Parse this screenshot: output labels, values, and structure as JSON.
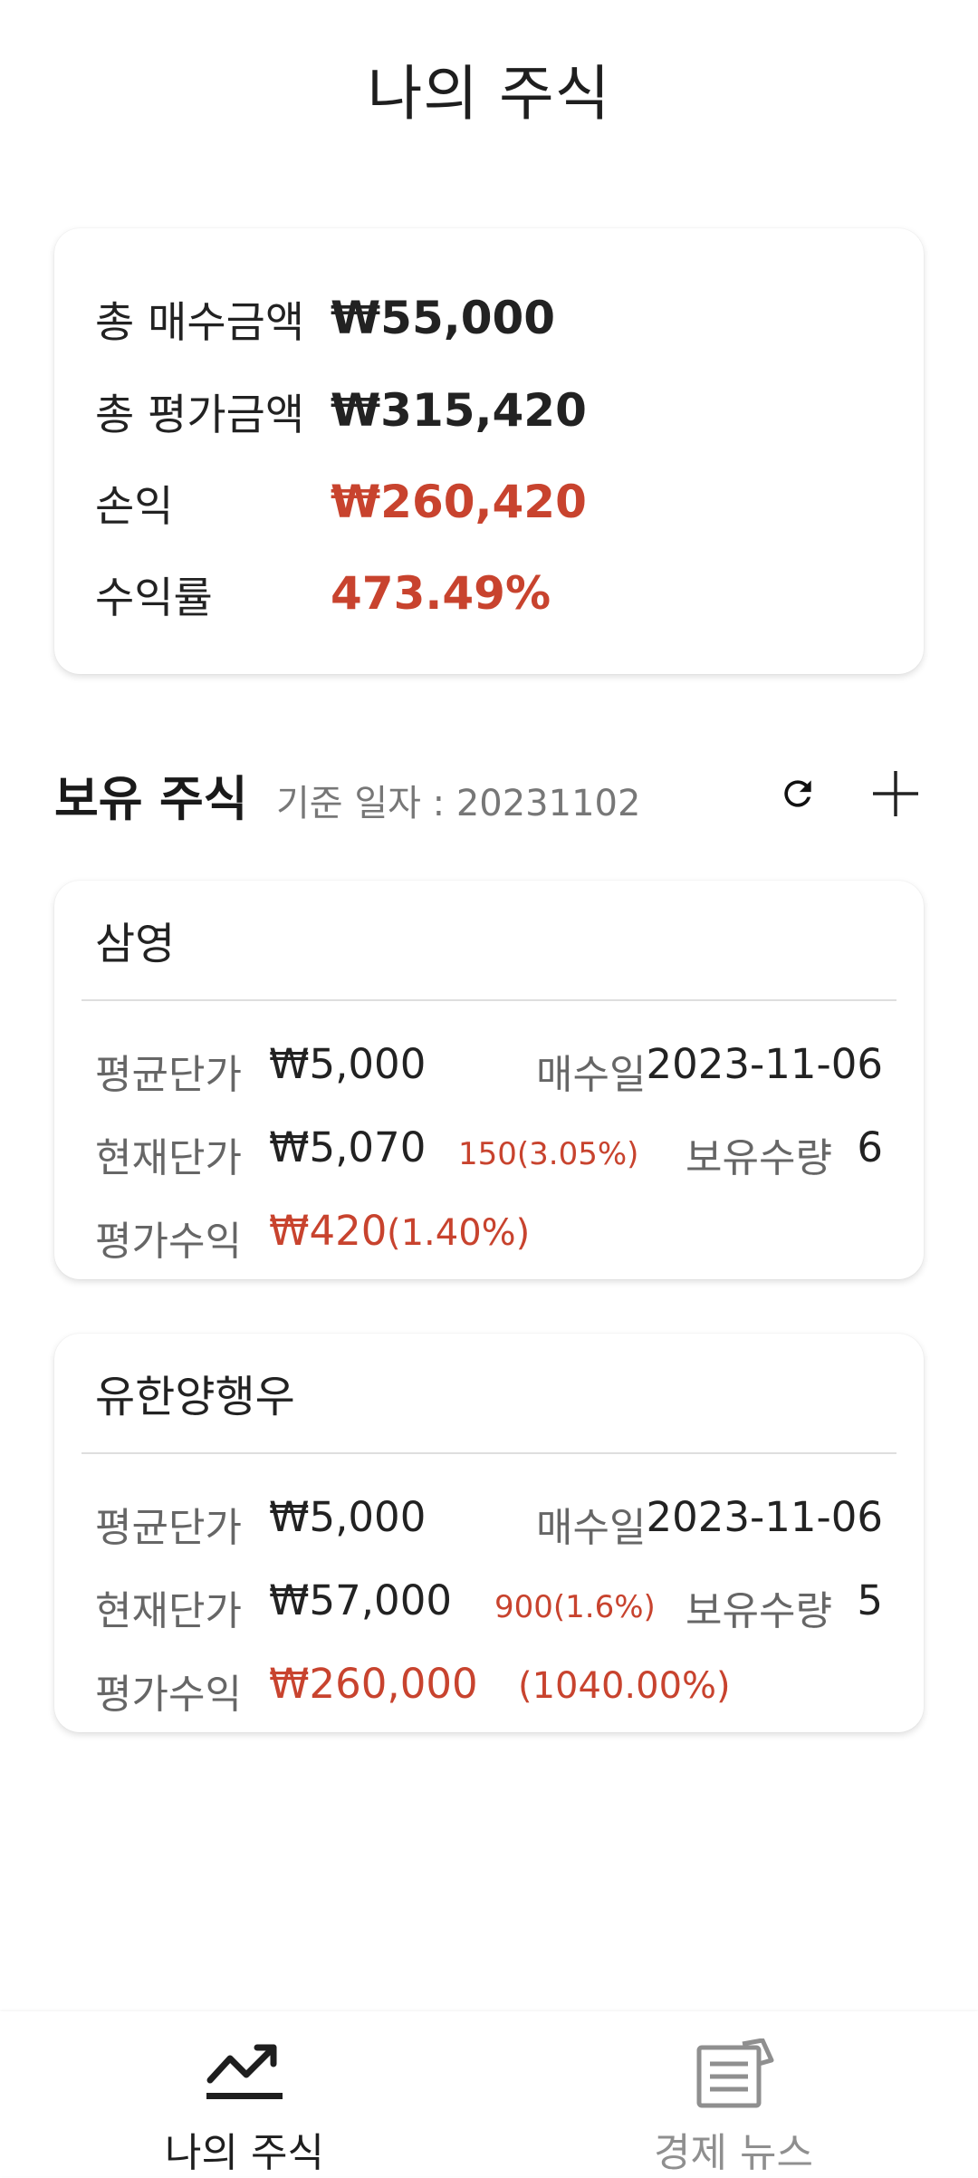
{
  "header": {
    "title": "나의 주식"
  },
  "summary": {
    "total_buy_label": "총 매수금액",
    "total_buy_value": "₩55,000",
    "total_eval_label": "총 평가금액",
    "total_eval_value": "₩315,420",
    "profit_label": "손익",
    "profit_value": "₩260,420",
    "return_label": "수익률",
    "return_value": "473.49%"
  },
  "holdings": {
    "title": "보유 주식",
    "base_date": "기준 일자 : 20231102",
    "refresh_icon": "refresh-icon",
    "add_icon": "plus-icon",
    "stocks": [
      {
        "name": "삼영",
        "avg_price_label": "평균단가",
        "avg_price": "₩5,000",
        "buy_date_label": "매수일",
        "buy_date": "2023-11-06",
        "cur_price_label": "현재단가",
        "cur_price": "₩5,070",
        "cur_change": "150(3.05%)",
        "qty_label": "보유수량",
        "qty": "6",
        "eval_label": "평가수익",
        "eval_value": "₩420",
        "eval_pct": "(1.40%)"
      },
      {
        "name": "유한양행우",
        "avg_price_label": "평균단가",
        "avg_price": "₩5,000",
        "buy_date_label": "매수일",
        "buy_date": "2023-11-06",
        "cur_price_label": "현재단가",
        "cur_price": "₩57,000",
        "cur_change": "900(1.6%)",
        "qty_label": "보유수량",
        "qty": "5",
        "eval_label": "평가수익",
        "eval_value": "₩260,000",
        "eval_pct": "(1040.00%)"
      }
    ]
  },
  "bottom_nav": {
    "items": [
      {
        "label": "나의 주식",
        "icon": "trending-up-icon",
        "active": true
      },
      {
        "label": "경제 뉴스",
        "icon": "newspaper-icon",
        "active": false
      }
    ]
  },
  "colors": {
    "accent_red": "#c8432e",
    "text": "#222222",
    "muted": "#666666",
    "inactive": "#8f8f8f"
  }
}
